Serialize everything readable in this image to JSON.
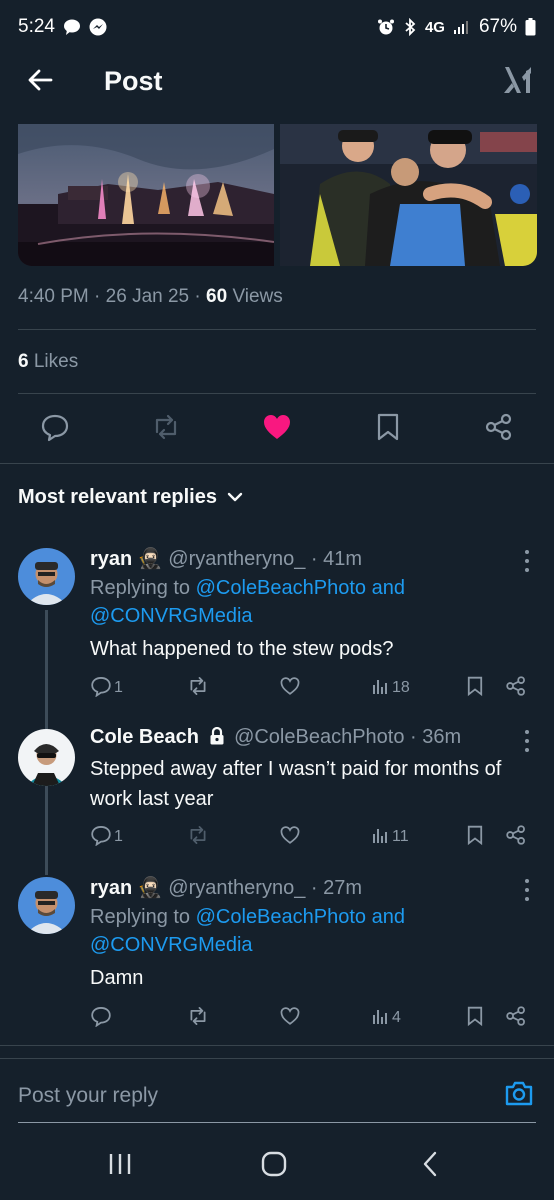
{
  "status_bar": {
    "time": "5:24",
    "network": "4G",
    "battery": "67%",
    "icons": [
      "chat-bubble-icon",
      "messenger-icon",
      "alarm-icon",
      "bluetooth-icon",
      "signal-icon",
      "battery-icon"
    ]
  },
  "header": {
    "title": "Post",
    "back_icon": "arrow-left-icon",
    "grok_icon": "grok-icon"
  },
  "media": [
    {
      "description_icon": "stadium-fireworks-photo"
    },
    {
      "description_icon": "team-hug-photo"
    }
  ],
  "post_meta": {
    "time": "4:40 PM",
    "date": "26 Jan 25",
    "views_count": "60",
    "views_label": "Views"
  },
  "likes": {
    "count": "6",
    "label": "Likes"
  },
  "actions": [
    "reply-icon",
    "repost-icon",
    "heart-filled-icon",
    "bookmark-icon",
    "share-icon"
  ],
  "colors": {
    "background": "#15202b",
    "accent_blue": "#1d9bf0",
    "like_pink": "#f91880",
    "muted": "#8b98a5",
    "divider": "#38444d"
  },
  "sort": {
    "label": "Most relevant replies"
  },
  "replies": [
    {
      "name": "ryan",
      "emoji": "🥷🏻",
      "handle": "@ryantheryno_",
      "time": "41m",
      "replying_prefix": "Replying to",
      "replying_to": "@ColeBeachPhoto and @CONVRGMedia",
      "replying_line1": "@ColeBeachPhoto and",
      "replying_line2": "@CONVRGMedia",
      "text": "What happened to the stew pods?",
      "reply_count": "1",
      "views": "18"
    },
    {
      "name": "Cole Beach",
      "locked": true,
      "handle": "@ColeBeachPhoto",
      "time": "36m",
      "text": "Stepped away after I wasn’t paid for months of work last year",
      "reply_count": "1",
      "views": "11"
    },
    {
      "name": "ryan",
      "emoji": "🥷🏻",
      "handle": "@ryantheryno_",
      "time": "27m",
      "replying_prefix": "Replying to",
      "replying_line1": "@ColeBeachPhoto and",
      "replying_line2": "@CONVRGMedia",
      "text": "Damn",
      "reply_count": "",
      "views": "4"
    }
  ],
  "reply_bar": {
    "placeholder": "Post your reply"
  }
}
